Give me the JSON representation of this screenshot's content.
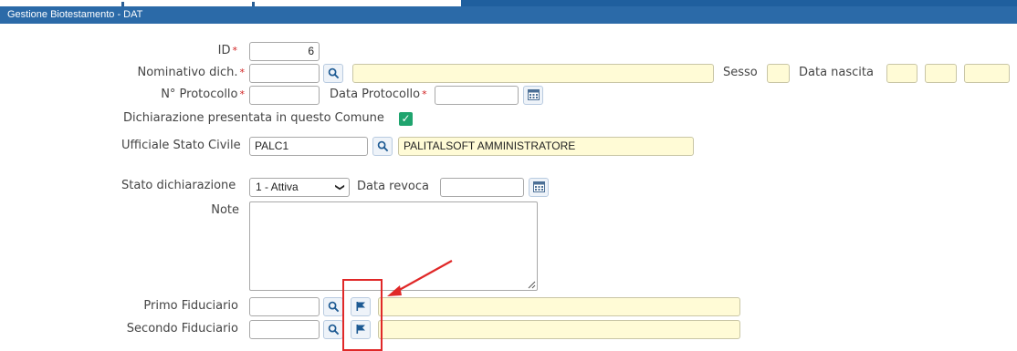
{
  "window": {
    "title": "Gestione Biotestamento - DAT"
  },
  "colors": {
    "title_bar": "#2b6aa8",
    "required": "#d02020",
    "checkbox": "#1fa46e",
    "highlight_field": "#fffbd6",
    "annotation": "#e02828"
  },
  "form": {
    "id": {
      "label": "ID",
      "required_mark": "*",
      "value": "6"
    },
    "nominativo": {
      "label": "Nominativo dich.",
      "required_mark": "*",
      "code": "",
      "name": ""
    },
    "sesso": {
      "label": "Sesso",
      "value": ""
    },
    "data_nascita": {
      "label": "Data nascita",
      "day": "",
      "month": "",
      "year": ""
    },
    "protocollo": {
      "label": "N° Protocollo",
      "required_mark": "*",
      "value": ""
    },
    "data_protocollo": {
      "label": "Data Protocollo",
      "required_mark": "*",
      "value": ""
    },
    "dichiarazione_comune": {
      "label": "Dichiarazione presentata in questo Comune",
      "checked": true,
      "check_glyph": "✓"
    },
    "ufficiale": {
      "label": "Ufficiale Stato Civile",
      "code": "PALC1",
      "name": "PALITALSOFT AMMINISTRATORE"
    },
    "stato": {
      "label": "Stato dichiarazione",
      "selected": "1 - Attiva",
      "arrow": "❯"
    },
    "data_revoca": {
      "label": "Data revoca",
      "value": ""
    },
    "note": {
      "label": "Note",
      "value": ""
    },
    "primo_fiduciario": {
      "label": "Primo Fiduciario",
      "code": "",
      "name": ""
    },
    "secondo_fiduciario": {
      "label": "Secondo Fiduciario",
      "code": "",
      "name": ""
    }
  },
  "icons": {
    "search": "search-icon",
    "calendar": "calendar-icon",
    "flag": "flag-icon"
  }
}
